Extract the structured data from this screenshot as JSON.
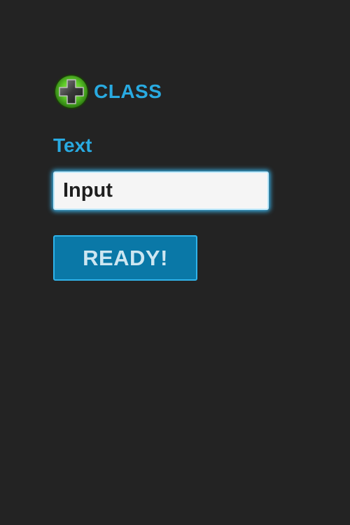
{
  "header": {
    "logo_icon": "medical-cross-icon",
    "title": "CLASS"
  },
  "form": {
    "field_label": "Text",
    "input_value": "Input",
    "submit_label": "READY!"
  },
  "colors": {
    "background": "#232323",
    "accent": "#29aae1",
    "button_fill": "#0a78a7",
    "logo_green": "#5ec92a"
  }
}
